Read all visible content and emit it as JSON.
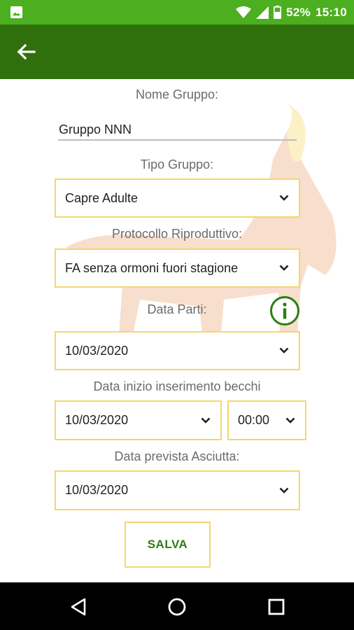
{
  "status_bar": {
    "battery_percent": "52%",
    "time": "15:10",
    "icons": [
      "image-icon",
      "wifi-icon",
      "signal-icon",
      "battery-icon"
    ]
  },
  "toolbar": {
    "back_icon": "arrow-left-icon"
  },
  "form": {
    "group_name_label": "Nome Gruppo:",
    "group_name_value": "Gruppo NNN",
    "group_type_label": "Tipo Gruppo:",
    "group_type_value": "Capre Adulte",
    "protocol_label": "Protocollo Riproduttivo:",
    "protocol_value": "FA senza ormoni fuori stagione",
    "births_date_label": "Data Parti:",
    "births_date_value": "10/03/2020",
    "bucks_start_label": "Data inizio inserimento becchi",
    "bucks_start_date_value": "10/03/2020",
    "bucks_start_time_value": "00:00",
    "dry_date_label": "Data prevista Asciutta:",
    "dry_date_value": "10/03/2020",
    "save_label": "SALVA"
  },
  "colors": {
    "status_bar": "#4caf1f",
    "toolbar": "#2f700c",
    "field_border": "#f3d86a",
    "accent_green": "#2e7d12"
  },
  "navbar": {
    "icons": [
      "back-triangle-icon",
      "home-circle-icon",
      "recents-square-icon"
    ]
  }
}
